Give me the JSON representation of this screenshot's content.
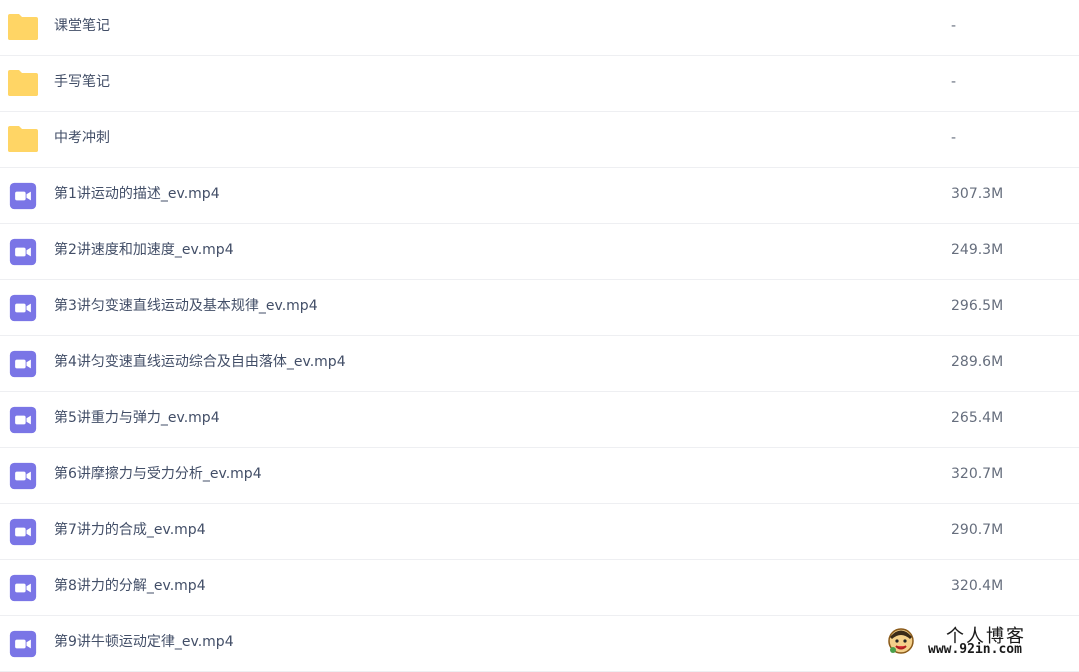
{
  "files": [
    {
      "name": "课堂笔记",
      "size": "-",
      "type": "folder"
    },
    {
      "name": "手写笔记",
      "size": "-",
      "type": "folder"
    },
    {
      "name": "中考冲刺",
      "size": "-",
      "type": "folder"
    },
    {
      "name": "第1讲运动的描述_ev.mp4",
      "size": "307.3M",
      "type": "video"
    },
    {
      "name": "第2讲速度和加速度_ev.mp4",
      "size": "249.3M",
      "type": "video"
    },
    {
      "name": "第3讲匀变速直线运动及基本规律_ev.mp4",
      "size": "296.5M",
      "type": "video"
    },
    {
      "name": "第4讲匀变速直线运动综合及自由落体_ev.mp4",
      "size": "289.6M",
      "type": "video"
    },
    {
      "name": "第5讲重力与弹力_ev.mp4",
      "size": "265.4M",
      "type": "video"
    },
    {
      "name": "第6讲摩擦力与受力分析_ev.mp4",
      "size": "320.7M",
      "type": "video"
    },
    {
      "name": "第7讲力的合成_ev.mp4",
      "size": "290.7M",
      "type": "video"
    },
    {
      "name": "第8讲力的分解_ev.mp4",
      "size": "320.4M",
      "type": "video"
    },
    {
      "name": "第9讲牛顿运动定律_ev.mp4",
      "size": "",
      "type": "video"
    }
  ],
  "icons": {
    "folder": "folder-icon",
    "video": "video-file-icon"
  },
  "colors": {
    "folder": "#ffd565",
    "video": "#7a75e6",
    "text": "#424e67",
    "size_text": "#666e7d",
    "divider": "#eeeff2"
  },
  "watermark": {
    "title": "个人博客",
    "url": "www.92in.com"
  }
}
